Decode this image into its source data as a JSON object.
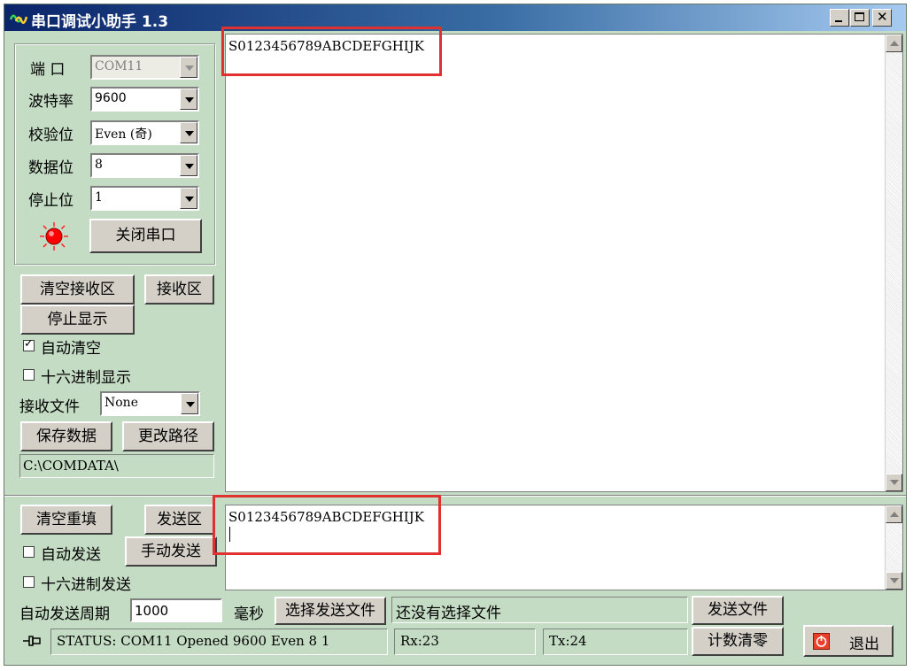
{
  "window": {
    "title": "串口调试小助手 1.3",
    "app_icon": "waveform-icon"
  },
  "title_buttons": [
    "minimize-icon",
    "maximize-icon",
    "close-icon"
  ],
  "port_settings": {
    "port_label": "端  口",
    "port_value": "COM11",
    "baud_label": "波特率",
    "baud_value": "9600",
    "parity_label": "校验位",
    "parity_value": "Even (奇)",
    "databits_label": "数据位",
    "databits_value": "8",
    "stopbits_label": "停止位",
    "stopbits_value": "1",
    "indicator_color": "#ff0000",
    "close_port_button": "关闭串口"
  },
  "receive": {
    "clear_button": "清空接收区",
    "area_label": "接收区",
    "stop_display_button": "停止显示",
    "auto_clear_label": "自动清空",
    "auto_clear_checked": true,
    "hex_display_label": "十六进制显示",
    "hex_display_checked": false,
    "file_label": "接收文件",
    "file_value": "None",
    "save_button": "保存数据",
    "change_path_button": "更改路径",
    "path_value": "C:\\COMDATA\\",
    "text": "S0123456789ABCDEFGHIJK"
  },
  "send": {
    "clear_button": "清空重填",
    "area_label": "发送区",
    "auto_send_label": "自动发送",
    "auto_send_checked": false,
    "manual_send_button": "手动发送",
    "hex_send_label": "十六进制发送",
    "hex_send_checked": false,
    "period_label": "自动发送周期",
    "period_value": "1000",
    "ms_label": "毫秒",
    "select_file_button": "选择发送文件",
    "file_status": "还没有选择文件",
    "send_file_button": "发送文件",
    "text": "S0123456789ABCDEFGHIJK"
  },
  "statusbar": {
    "pin_icon": "pin-icon",
    "status_text": "STATUS: COM11 Opened 9600 Even  8 1",
    "rx": "Rx:23",
    "tx": "Tx:24",
    "reset_count_button": "计数清零",
    "exit_button": "退出"
  },
  "colors": {
    "background": "#c4dcc4",
    "highlight_box": "#e03030",
    "title_start": "#0a246a"
  }
}
